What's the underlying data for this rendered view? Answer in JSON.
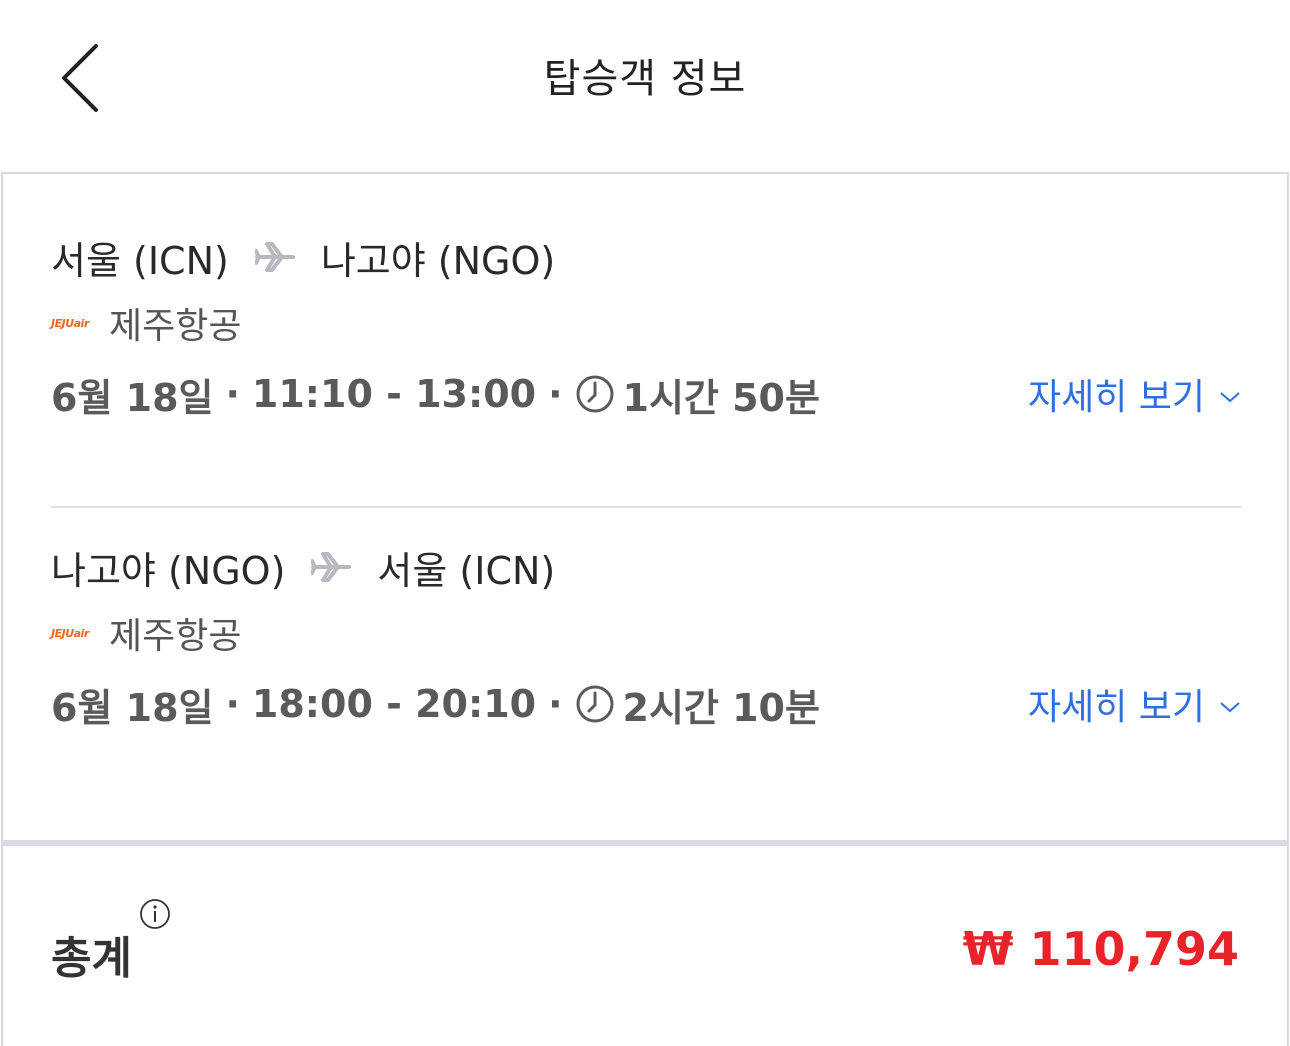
{
  "header": {
    "title": "탑승객 정보"
  },
  "flights": [
    {
      "origin": "서울 (ICN)",
      "destination": "나고야 (NGO)",
      "airline_logo_text": "JEJUair",
      "airline": "제주항공",
      "date": "6월 18일",
      "time_range": "11:10 - 13:00",
      "duration": "1시간 50분",
      "detail_label": "자세히 보기"
    },
    {
      "origin": "나고야 (NGO)",
      "destination": "서울 (ICN)",
      "airline_logo_text": "JEJUair",
      "airline": "제주항공",
      "date": "6월 18일",
      "time_range": "18:00 - 20:10",
      "duration": "2시간 10분",
      "detail_label": "자세히 보기"
    }
  ],
  "separator": "·",
  "total": {
    "label": "총계",
    "amount": "₩ 110,794"
  },
  "colors": {
    "accent_link": "#2f6fe0",
    "price": "#e8242a",
    "airline_brand": "#f26522"
  },
  "icons": {
    "back": "chevron-left-icon",
    "route": "airplane-icon",
    "duration": "clock-icon",
    "expand": "chevron-down-icon",
    "info": "info-icon"
  }
}
